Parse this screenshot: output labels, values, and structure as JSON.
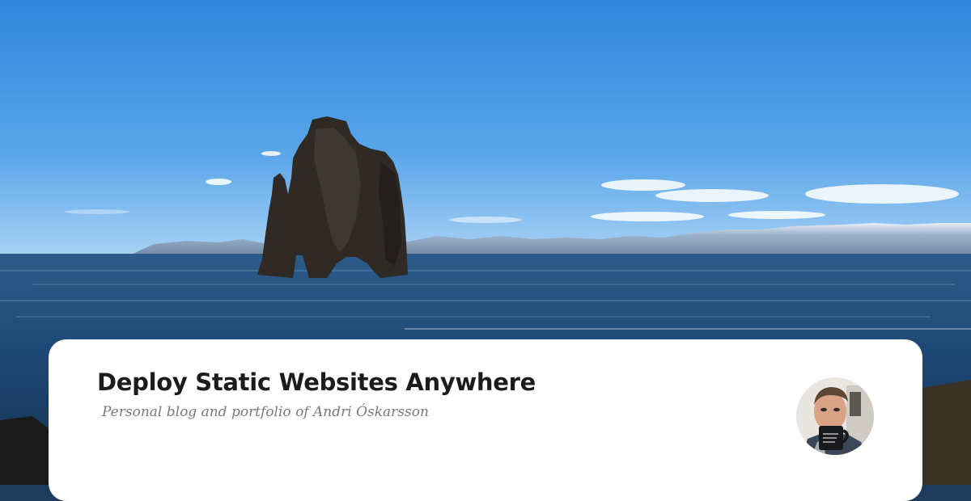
{
  "card": {
    "title": "Deploy Static Websites Anywhere",
    "subtitle": "Personal blog and portfolio of Andri Óskarsson"
  },
  "hero": {
    "icon": "sea-stack-landscape-photo"
  },
  "avatar": {
    "icon": "author-portrait-photo"
  },
  "colors": {
    "sky_top": "#2f86dc",
    "sky_bottom": "#a9d2f4",
    "sea": "#1f4a78",
    "rock": "#2f2a26",
    "card": "#ffffff",
    "title": "#1c1c1c",
    "subtitle": "#7a7a7a"
  }
}
